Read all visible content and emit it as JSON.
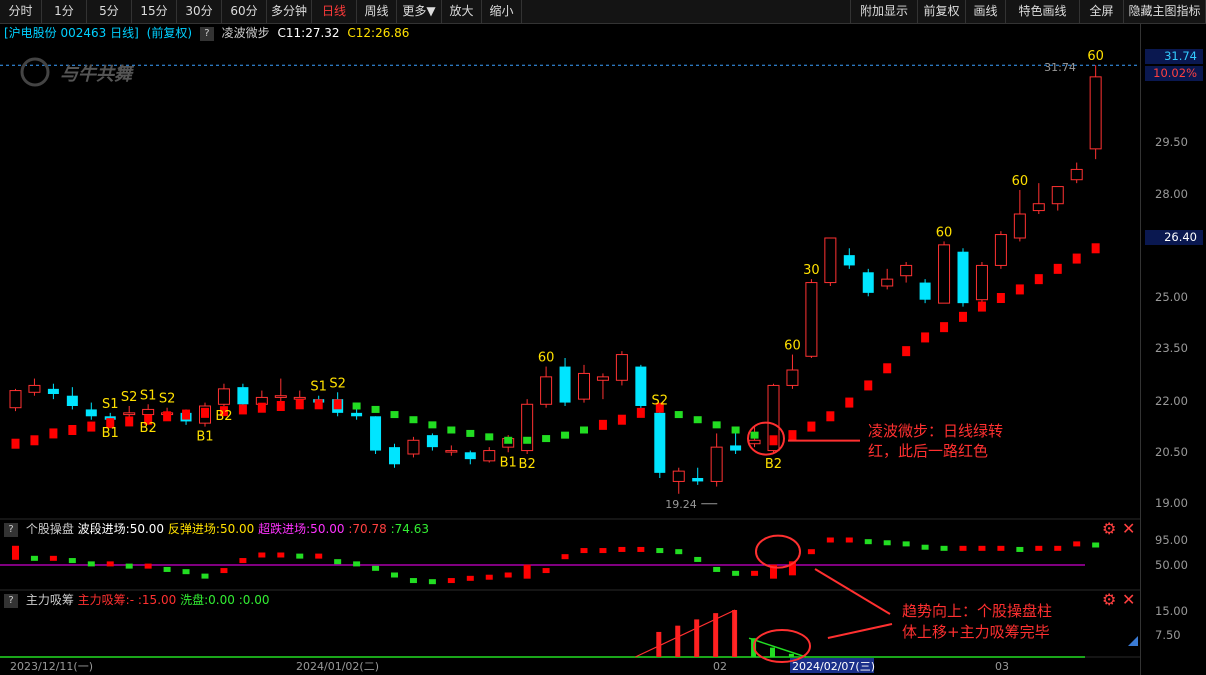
{
  "toolbar": {
    "left": [
      "分时",
      "1分",
      "5分",
      "15分",
      "30分",
      "60分",
      "多分钟",
      "日线",
      "周线",
      "更多▼",
      "放大",
      "缩小"
    ],
    "active": "日线",
    "right": [
      "附加显示",
      "前复权",
      "画线",
      "特色画线",
      "全屏",
      "隐藏主图指标"
    ]
  },
  "info": {
    "stock": "[沪电股份 002463 日线]",
    "adjust": "(前复权)",
    "indicator": "凌波微步",
    "c1": "C11:27.32",
    "c2": "C12:26.86"
  },
  "watermark": "与牛共舞",
  "axis": {
    "top_price": "31.74",
    "top_pct": "10.02%",
    "current": "26.40",
    "ticks": [
      "29.50",
      "28.00",
      "25.00",
      "23.50",
      "22.00",
      "20.50",
      "19.00"
    ],
    "sub1_ticks": [
      "95.00",
      "50.00"
    ],
    "sub2_ticks": [
      "15.00",
      "7.50"
    ]
  },
  "chart_labels": {
    "high_label": "31:74",
    "low_label": "19.24",
    "markers": [
      {
        "t": "S1",
        "i": 5,
        "pos": "above"
      },
      {
        "t": "B1",
        "i": 5,
        "pos": "below"
      },
      {
        "t": "S2",
        "i": 6,
        "pos": "above"
      },
      {
        "t": "S1",
        "i": 7,
        "pos": "above"
      },
      {
        "t": "B2",
        "i": 7,
        "pos": "below"
      },
      {
        "t": "S2",
        "i": 8,
        "pos": "above"
      },
      {
        "t": "B1",
        "i": 10,
        "pos": "below"
      },
      {
        "t": "B2",
        "i": 11,
        "pos": "below"
      },
      {
        "t": "S1",
        "i": 16,
        "pos": "above"
      },
      {
        "t": "S2",
        "i": 17,
        "pos": "above"
      },
      {
        "t": "B1",
        "i": 26,
        "pos": "below"
      },
      {
        "t": "B2",
        "i": 27,
        "pos": "below"
      },
      {
        "t": "60",
        "i": 28,
        "pos": "above"
      },
      {
        "t": "S2",
        "i": 34,
        "pos": "above"
      },
      {
        "t": "B2",
        "i": 40,
        "pos": "below"
      },
      {
        "t": "60",
        "i": 41,
        "pos": "above"
      },
      {
        "t": "30",
        "i": 42,
        "pos": "above"
      },
      {
        "t": "60",
        "i": 49,
        "pos": "above"
      },
      {
        "t": "60",
        "i": 53,
        "pos": "above"
      },
      {
        "t": "60",
        "i": 57,
        "pos": "above"
      }
    ]
  },
  "annotation1": {
    "line1": "凌波微步：日线绿转",
    "line2": "红，此后一路红色"
  },
  "annotation2": {
    "line1": "趋势向上：个股操盘柱",
    "line2": "体上移+主力吸筹完毕"
  },
  "sub1": {
    "name": "个股操盘",
    "a_label": "波段进场:50.00",
    "b_label": "反弹进场:50.00",
    "c_label": "超跌进场:50.00",
    "d_label": ":70.78",
    "e_label": ":74.63"
  },
  "sub2": {
    "name": "主力吸筹",
    "a_label": "主力吸筹:-",
    "b_label": ":15.00",
    "c_label": "洗盘:0.00",
    "d_label": ":0.00"
  },
  "dates": [
    "2023/12/11(一)",
    "2024/01/02(二)",
    "02",
    "2024/02/07(三)",
    "03"
  ],
  "colors": {
    "up": "#ff3232",
    "down": "#00e5ff",
    "bg": "#000000",
    "dot_up": "#ff0000",
    "dot_down": "#22dd22",
    "annot": "#ff3030",
    "marker": "#ffe000",
    "purple": "#cc00cc"
  },
  "chart_data": {
    "type": "candlestick",
    "ylim": [
      18.6,
      32.2
    ],
    "candles": [
      [
        21.75,
        22.25,
        21.65,
        22.3
      ],
      [
        22.2,
        22.4,
        22.1,
        22.6
      ],
      [
        22.3,
        22.15,
        22.0,
        22.45
      ],
      [
        22.1,
        21.8,
        21.7,
        22.35
      ],
      [
        21.7,
        21.5,
        21.4,
        21.9
      ],
      [
        21.5,
        21.4,
        21.3,
        21.6
      ],
      [
        21.55,
        21.6,
        21.4,
        21.8
      ],
      [
        21.55,
        21.7,
        21.45,
        21.85
      ],
      [
        21.55,
        21.6,
        21.45,
        21.75
      ],
      [
        21.6,
        21.35,
        21.25,
        21.7
      ],
      [
        21.3,
        21.8,
        21.2,
        21.9
      ],
      [
        21.85,
        22.3,
        21.8,
        22.45
      ],
      [
        22.35,
        21.85,
        21.75,
        22.45
      ],
      [
        21.85,
        22.05,
        21.8,
        22.25
      ],
      [
        22.05,
        22.1,
        21.9,
        22.6
      ],
      [
        22.0,
        22.05,
        21.95,
        22.25
      ],
      [
        22.0,
        21.9,
        21.8,
        22.1
      ],
      [
        22.0,
        21.6,
        21.5,
        22.2
      ],
      [
        21.6,
        21.5,
        21.4,
        21.7
      ],
      [
        21.5,
        20.5,
        20.4,
        21.5
      ],
      [
        20.6,
        20.1,
        20.0,
        20.7
      ],
      [
        20.4,
        20.8,
        20.3,
        20.9
      ],
      [
        20.95,
        20.6,
        20.5,
        21.0
      ],
      [
        20.5,
        20.5,
        20.35,
        20.65
      ],
      [
        20.45,
        20.25,
        20.1,
        20.5
      ],
      [
        20.2,
        20.5,
        20.15,
        20.6
      ],
      [
        20.6,
        20.85,
        20.45,
        20.95
      ],
      [
        20.5,
        21.85,
        20.4,
        22.0
      ],
      [
        21.85,
        22.65,
        21.75,
        22.95
      ],
      [
        22.95,
        21.9,
        21.8,
        23.2
      ],
      [
        22.0,
        22.75,
        21.9,
        23.0
      ],
      [
        22.55,
        22.65,
        22.0,
        22.75
      ],
      [
        22.55,
        23.3,
        22.4,
        23.4
      ],
      [
        22.95,
        21.8,
        21.7,
        23.0
      ],
      [
        21.6,
        19.85,
        19.7,
        21.7
      ],
      [
        19.6,
        19.9,
        19.24,
        20.0
      ],
      [
        19.7,
        19.6,
        19.5,
        20.0
      ],
      [
        19.6,
        20.6,
        19.45,
        21.0
      ],
      [
        20.65,
        20.5,
        20.4,
        21.2
      ],
      [
        20.7,
        20.8,
        20.6,
        21.2
      ],
      [
        20.5,
        22.4,
        20.4,
        22.45
      ],
      [
        22.4,
        22.85,
        22.3,
        23.3
      ],
      [
        23.25,
        25.4,
        23.2,
        25.5
      ],
      [
        25.4,
        26.7,
        25.3,
        26.7
      ],
      [
        26.2,
        25.9,
        25.8,
        26.4
      ],
      [
        25.7,
        25.1,
        25.0,
        25.8
      ],
      [
        25.3,
        25.5,
        25.2,
        25.8
      ],
      [
        25.6,
        25.9,
        25.4,
        26.0
      ],
      [
        25.4,
        24.9,
        24.8,
        25.5
      ],
      [
        24.8,
        26.5,
        24.8,
        26.6
      ],
      [
        26.3,
        24.8,
        24.7,
        26.4
      ],
      [
        24.9,
        25.9,
        24.8,
        26.0
      ],
      [
        25.9,
        26.8,
        25.8,
        26.9
      ],
      [
        26.7,
        27.4,
        26.6,
        28.1
      ],
      [
        27.5,
        27.7,
        27.4,
        28.3
      ],
      [
        27.7,
        28.2,
        27.5,
        28.0
      ],
      [
        28.4,
        28.7,
        28.3,
        28.9
      ],
      [
        29.3,
        31.4,
        29.0,
        31.74
      ]
    ],
    "trail": [
      20.7,
      20.8,
      21.0,
      21.1,
      21.2,
      21.3,
      21.35,
      21.4,
      21.5,
      21.55,
      21.6,
      21.65,
      21.7,
      21.75,
      21.8,
      21.85,
      21.85,
      21.85,
      21.8,
      21.7,
      21.55,
      21.4,
      21.25,
      21.1,
      21.0,
      20.9,
      20.8,
      20.8,
      20.85,
      20.95,
      21.1,
      21.25,
      21.4,
      21.6,
      21.75,
      21.55,
      21.4,
      21.25,
      21.1,
      20.95,
      20.8,
      20.95,
      21.2,
      21.5,
      21.9,
      22.4,
      22.9,
      23.4,
      23.8,
      24.1,
      24.4,
      24.7,
      24.95,
      25.2,
      25.5,
      25.8,
      26.1,
      26.4
    ],
    "trail_up": [
      1,
      1,
      1,
      1,
      1,
      1,
      1,
      1,
      1,
      1,
      1,
      1,
      1,
      1,
      1,
      1,
      1,
      1,
      0,
      0,
      0,
      0,
      0,
      0,
      0,
      0,
      0,
      0,
      0,
      0,
      0,
      1,
      1,
      1,
      1,
      0,
      0,
      0,
      0,
      0,
      1,
      1,
      1,
      1,
      1,
      1,
      1,
      1,
      1,
      1,
      1,
      1,
      1,
      1,
      1,
      1,
      1,
      1
    ],
    "sub1": [
      72,
      62,
      62,
      58,
      52,
      52,
      48,
      48,
      42,
      38,
      30,
      40,
      58,
      68,
      68,
      66,
      66,
      56,
      52,
      44,
      32,
      22,
      20,
      22,
      26,
      28,
      32,
      38,
      40,
      65,
      76,
      76,
      78,
      78,
      76,
      74,
      60,
      42,
      35,
      35,
      38,
      44,
      74,
      95,
      95,
      92,
      90,
      88,
      82,
      80,
      80,
      80,
      80,
      78,
      80,
      80,
      88,
      86,
      82,
      84,
      86
    ],
    "sub2": [
      0,
      0,
      0,
      0,
      0,
      0,
      0,
      0,
      0,
      0,
      0,
      0,
      0,
      0,
      0,
      0,
      0,
      0,
      0,
      0,
      0,
      0,
      0,
      0,
      0,
      0,
      0,
      0,
      0,
      0,
      0,
      0,
      0,
      0,
      8,
      10,
      12,
      14,
      15,
      6,
      3,
      1,
      0,
      0,
      0,
      0,
      0,
      0,
      0,
      0,
      0,
      0,
      0,
      0,
      0,
      0,
      0,
      0
    ]
  }
}
